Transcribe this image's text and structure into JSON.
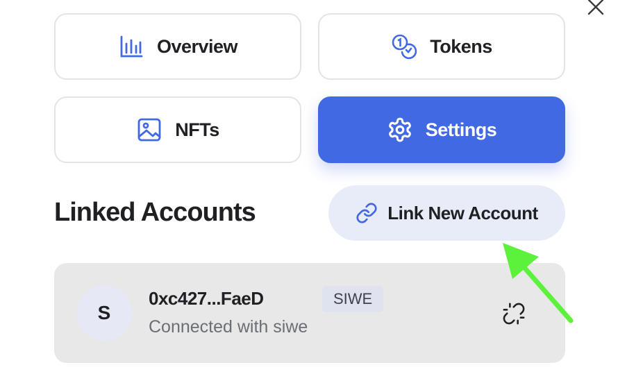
{
  "nav": {
    "close_icon": "x-icon",
    "tiles": {
      "overview": {
        "label": "Overview",
        "icon": "bar-chart-icon"
      },
      "tokens": {
        "label": "Tokens",
        "icon": "coins-icon"
      },
      "nfts": {
        "label": "NFTs",
        "icon": "image-icon"
      },
      "settings": {
        "label": "Settings",
        "icon": "gear-icon",
        "active": true
      }
    }
  },
  "linked_accounts": {
    "title": "Linked Accounts",
    "link_button_label": "Link New Account",
    "link_button_icon": "link-icon",
    "accounts": [
      {
        "avatar_letter": "S",
        "address": "0xc427...FaeD",
        "badge": "SIWE",
        "subtitle": "Connected with siwe",
        "action_icon": "unlink-icon"
      }
    ]
  },
  "colors": {
    "accent": "#4169e1",
    "link_button_bg": "#e8ecf8",
    "card_bg": "#e8e8e8",
    "annotation_arrow": "#5cf23c"
  }
}
